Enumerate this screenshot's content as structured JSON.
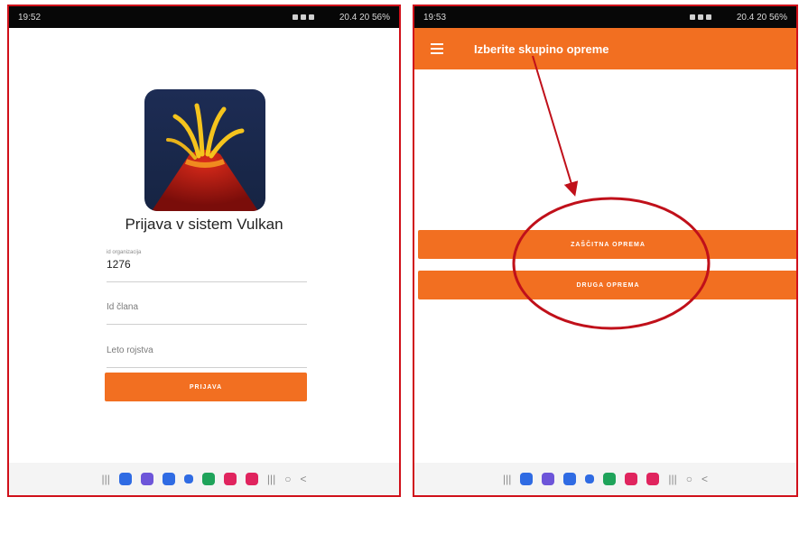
{
  "left_screen": {
    "status": {
      "time": "19:52",
      "right": "20.4 20 56%"
    },
    "title": "Prijava v sistem Vulkan",
    "org_field": {
      "label": "id organizacija",
      "value": "1276"
    },
    "member_field": {
      "placeholder": "Id člana"
    },
    "birth_field": {
      "placeholder": "Leto rojstva"
    },
    "login_button": "PRIJAVA"
  },
  "right_screen": {
    "status": {
      "time": "19:53",
      "right": "20.4 20 56%"
    },
    "appbar_title": "Izberite skupino opreme",
    "buttons": [
      "ZAŠČITNA OPREMA",
      "DRUGA OPREMA"
    ]
  },
  "navbar": {
    "recent_glyph": "|||",
    "home_glyph": "○",
    "back_glyph": "<",
    "app_icon_colors": [
      "#2f6be3",
      "#6d55d9",
      "#2f6be3",
      "#2f6be3",
      "#1fa35a",
      "#e0245e",
      "#e0245e"
    ]
  },
  "colors": {
    "accent": "#f26f21",
    "annotation": "#c0101a",
    "border": "#d0101a"
  }
}
